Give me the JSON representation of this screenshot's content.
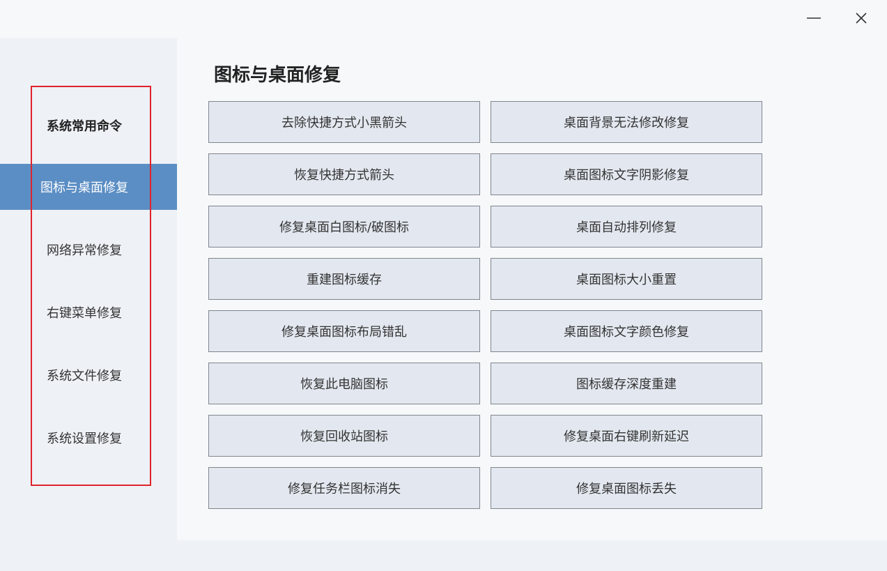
{
  "window": {
    "minimize_icon": "minimize-icon",
    "close_icon": "close-icon"
  },
  "sidebar": {
    "items": [
      {
        "label": "系统常用命令"
      },
      {
        "label": "图标与桌面修复"
      },
      {
        "label": "网络异常修复"
      },
      {
        "label": "右键菜单修复"
      },
      {
        "label": "系统文件修复"
      },
      {
        "label": "系统设置修复"
      }
    ],
    "active_index": 1
  },
  "main": {
    "title": "图标与桌面修复",
    "buttons": [
      {
        "label": "去除快捷方式小黑箭头"
      },
      {
        "label": "桌面背景无法修改修复"
      },
      {
        "label": "恢复快捷方式箭头"
      },
      {
        "label": "桌面图标文字阴影修复"
      },
      {
        "label": "修复桌面白图标/破图标"
      },
      {
        "label": "桌面自动排列修复"
      },
      {
        "label": "重建图标缓存"
      },
      {
        "label": "桌面图标大小重置"
      },
      {
        "label": "修复桌面图标布局错乱"
      },
      {
        "label": "桌面图标文字颜色修复"
      },
      {
        "label": "恢复此电脑图标"
      },
      {
        "label": "图标缓存深度重建"
      },
      {
        "label": "恢复回收站图标"
      },
      {
        "label": "修复桌面右键刷新延迟"
      },
      {
        "label": "修复任务栏图标消失"
      },
      {
        "label": "修复桌面图标丢失"
      }
    ]
  },
  "colors": {
    "accent": "#5b8ec4",
    "highlight_border": "#e0232b",
    "button_bg": "#e3e8f0"
  }
}
